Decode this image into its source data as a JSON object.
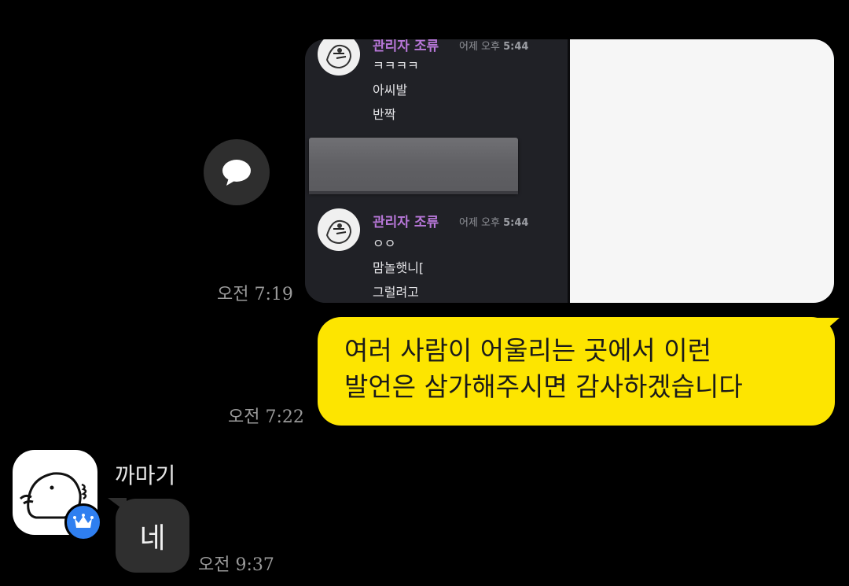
{
  "share_button": {
    "icon": "speech-bubble-icon"
  },
  "image_message": {
    "messages": [
      {
        "author": "관리자 조류",
        "time_prefix": "어제 오후",
        "time": "5:44",
        "lines": [
          "ㅋㅋㅋㅋ",
          "아씨발",
          "반짝"
        ]
      },
      {
        "author": "관리자 조류",
        "time_prefix": "어제 오후",
        "time": "5:44",
        "lines": [
          "ㅇㅇ",
          "맘놀햇니[",
          "그럴려고"
        ]
      }
    ],
    "timestamp": "오전 7:19"
  },
  "my_message": {
    "text_line1": "여러 사람이 어울리는 곳에서 이런",
    "text_line2": "발언은 삼가해주시면 감사하겠습니다",
    "timestamp": "오전 7:22",
    "bubble_color": "#fde500"
  },
  "reply": {
    "sender_name": "까마기",
    "badge_icon": "crown-icon",
    "badge_color": "#2f7ff0",
    "text": "네",
    "timestamp": "오전 9:37"
  }
}
